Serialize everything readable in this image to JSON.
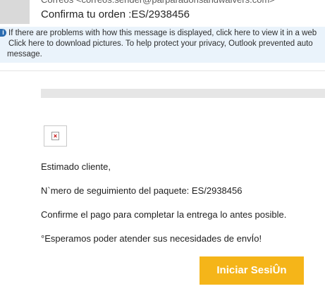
{
  "header": {
    "sender": "Correos <correos.sender@parparadonsandwaivers.com>",
    "subject": "Confirma tu orden :ES/2938456"
  },
  "infobar": {
    "icon": "info-icon",
    "line1": "If there are problems with how this message is displayed, click here to view it in a web",
    "line2": "Click here to download pictures. To help protect your privacy, Outlook prevented auto",
    "line3": "message."
  },
  "email": {
    "broken_image_icon": "broken-image-icon",
    "greeting": "Estimado cliente,",
    "tracking": "N`mero de seguimiento del paquete: ES/2938456",
    "confirm": "Confirme el pago para completar la entrega lo antes posible.",
    "closing": "°Esperamos poder atender sus necesidades de envÍo!",
    "cta_label": "Iniciar SesiÛn"
  },
  "colors": {
    "cta_bg": "#f5b519",
    "infobar_bg": "#eaf3fb"
  }
}
